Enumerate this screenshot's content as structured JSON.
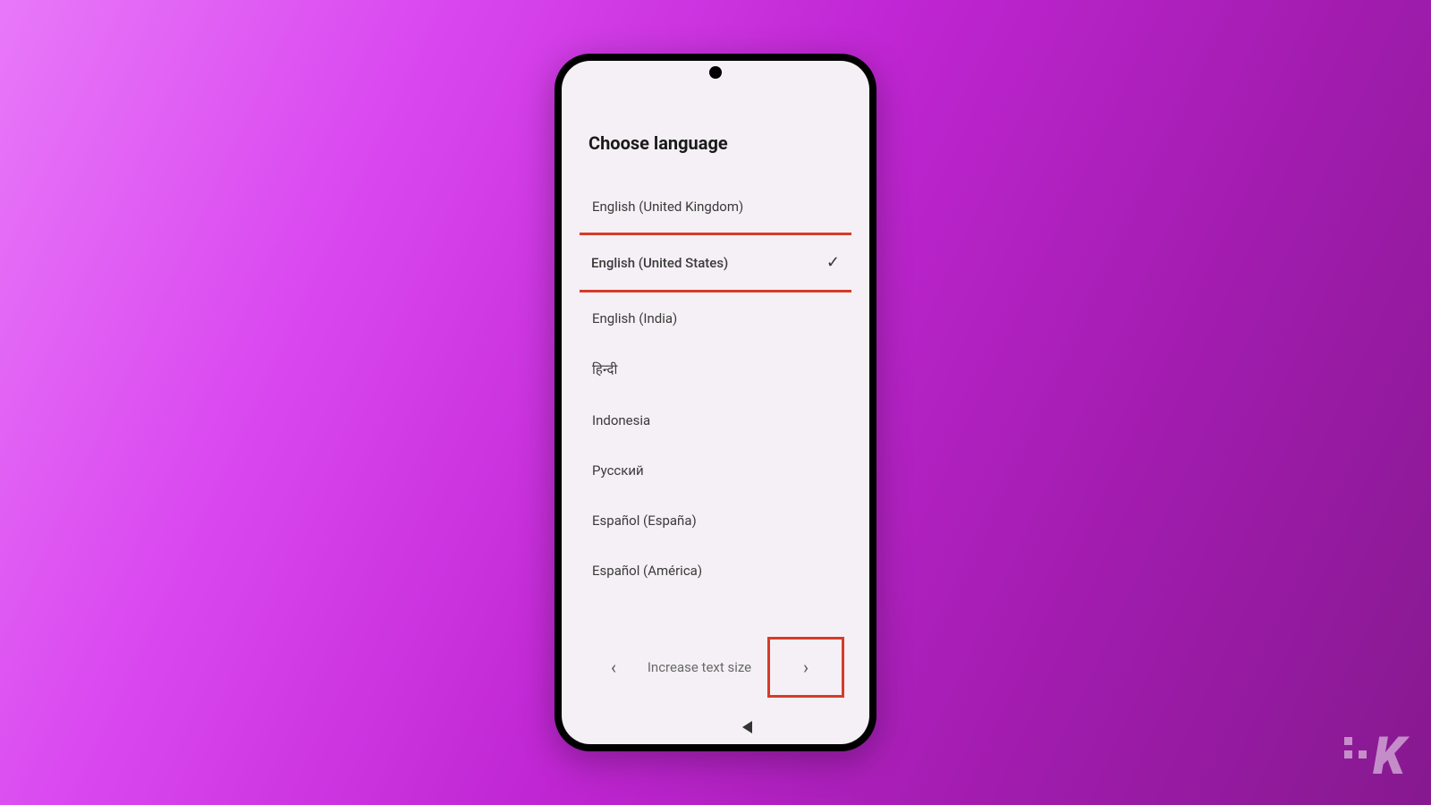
{
  "page": {
    "title": "Choose language"
  },
  "languages": [
    {
      "label": "English (United Kingdom)",
      "selected": false
    },
    {
      "label": "English (United States)",
      "selected": true
    },
    {
      "label": "English (India)",
      "selected": false
    },
    {
      "label": "हिन्दी",
      "selected": false
    },
    {
      "label": "Indonesia",
      "selected": false
    },
    {
      "label": "Русский",
      "selected": false
    },
    {
      "label": "Español (España)",
      "selected": false
    },
    {
      "label": "Español (América)",
      "selected": false
    }
  ],
  "footer": {
    "prev_icon": "‹",
    "text_size_label": "Increase text size",
    "next_icon": "›"
  },
  "watermark": {
    "letter": "K"
  },
  "annotation": {
    "highlight_color": "#d63b2a"
  }
}
